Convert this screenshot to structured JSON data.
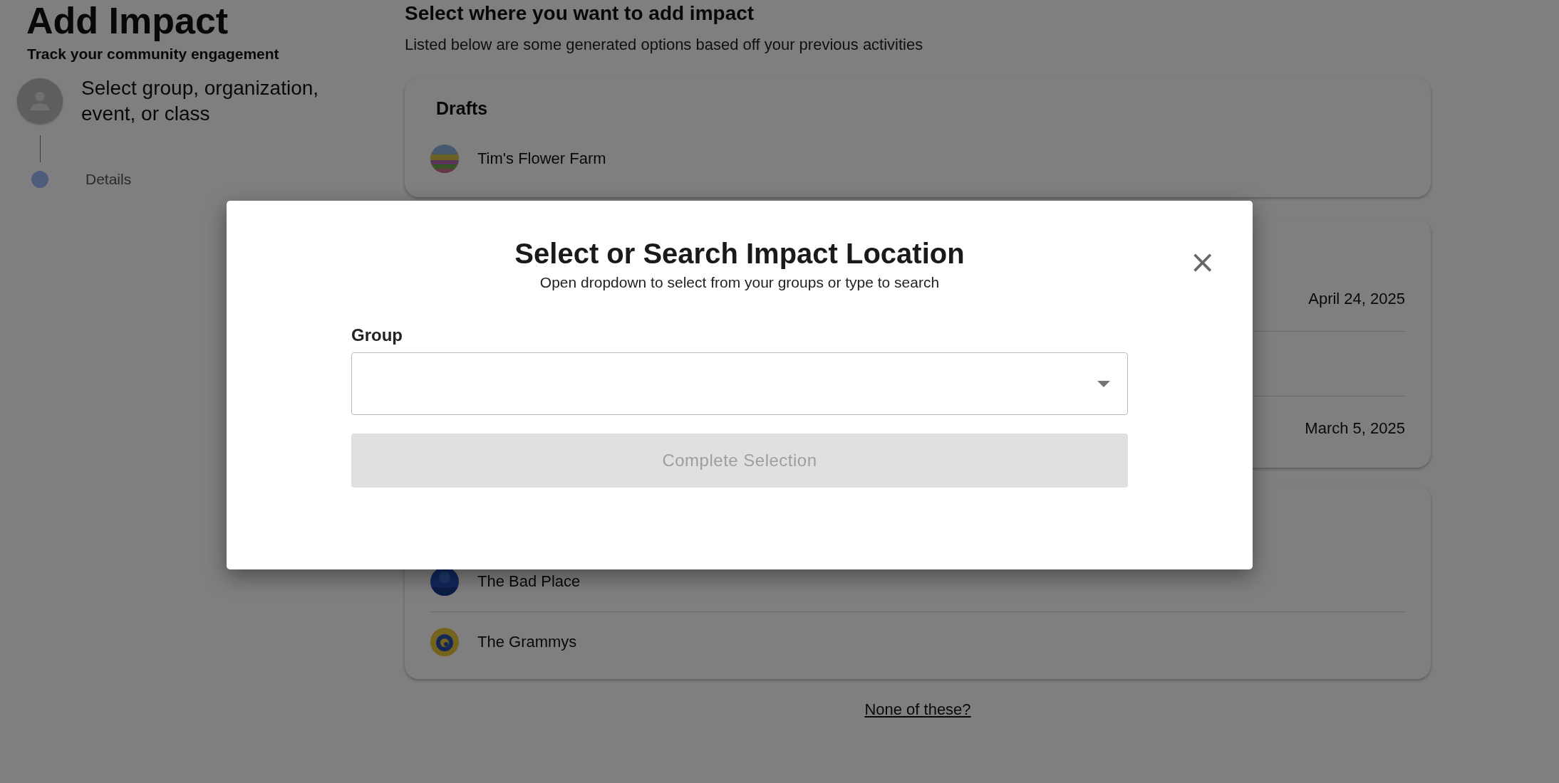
{
  "page": {
    "title": "Add Impact",
    "subtitle": "Track your community engagement"
  },
  "steps": [
    {
      "label": "Select group, organization, event, or class",
      "kind": "avatar",
      "active": true
    },
    {
      "label": "Details",
      "kind": "dot",
      "active": false
    }
  ],
  "main": {
    "heading": "Select where you want to add impact",
    "description": "Listed below are some generated options based off your previous activities"
  },
  "cards": [
    {
      "title": "Drafts",
      "rows": [
        {
          "name": "Tim's Flower Farm",
          "kind": "picture"
        }
      ]
    },
    {
      "rows": [
        {
          "date": "April 24, 2025"
        },
        {},
        {
          "date": "March 5, 2025"
        }
      ]
    },
    {
      "rows": [
        {
          "name": "The Bad Place",
          "kind": "picture"
        },
        {
          "name": "The Grammys",
          "kind": "picture"
        }
      ]
    }
  ],
  "none_link": "None of these?",
  "dialog": {
    "title": "Select or Search Impact Location",
    "subtitle": "Open dropdown to select from your groups or type to search",
    "close": "×",
    "field": {
      "label": "Group"
    },
    "button": {
      "label": "Complete Selection",
      "disabled": true
    }
  }
}
